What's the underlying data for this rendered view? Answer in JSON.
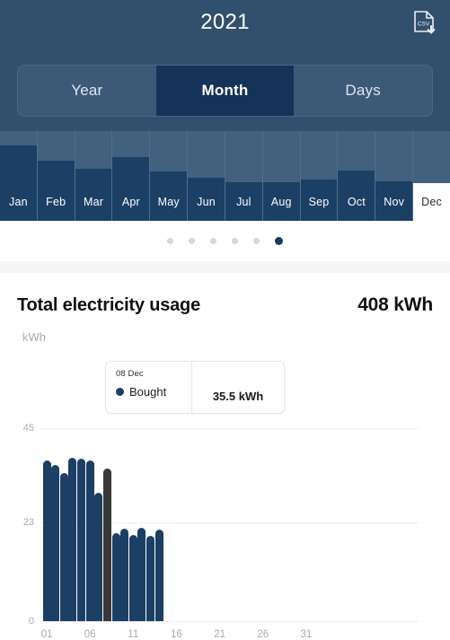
{
  "header": {
    "title": "2021",
    "export_icon": "csv-download-icon"
  },
  "segmented_control": {
    "options": [
      {
        "label": "Year",
        "active": false
      },
      {
        "label": "Month",
        "active": true
      },
      {
        "label": "Days",
        "active": false
      }
    ]
  },
  "month_strip": {
    "months": [
      {
        "label": "Jan",
        "fill_pct": 84,
        "selected": false
      },
      {
        "label": "Feb",
        "fill_pct": 67,
        "selected": false
      },
      {
        "label": "Mar",
        "fill_pct": 58,
        "selected": false
      },
      {
        "label": "Apr",
        "fill_pct": 71,
        "selected": false
      },
      {
        "label": "May",
        "fill_pct": 55,
        "selected": false
      },
      {
        "label": "Jun",
        "fill_pct": 48,
        "selected": false
      },
      {
        "label": "Jul",
        "fill_pct": 43,
        "selected": false
      },
      {
        "label": "Aug",
        "fill_pct": 43,
        "selected": false
      },
      {
        "label": "Sep",
        "fill_pct": 46,
        "selected": false
      },
      {
        "label": "Oct",
        "fill_pct": 56,
        "selected": false
      },
      {
        "label": "Nov",
        "fill_pct": 44,
        "selected": false
      },
      {
        "label": "Dec",
        "fill_pct": 42,
        "selected": true
      }
    ]
  },
  "pagination": {
    "total": 6,
    "active_index": 5
  },
  "usage": {
    "title": "Total electricity usage",
    "value": "408 kWh",
    "unit_label": "kWh"
  },
  "tooltip": {
    "date": "08 Dec",
    "series_label": "Bought",
    "series_color": "#1c3f65",
    "value": "35.5 kWh"
  },
  "chart_data": {
    "type": "bar",
    "title": "Total electricity usage",
    "xlabel": "",
    "ylabel": "kWh",
    "ylim": [
      0,
      45
    ],
    "yticks": [
      0,
      23,
      45
    ],
    "ytick_labels": [
      "0",
      "23",
      "45"
    ],
    "xlim": [
      1,
      31
    ],
    "xticks": [
      1,
      6,
      11,
      16,
      21,
      26,
      31
    ],
    "xtick_labels": [
      "01",
      "06",
      "11",
      "16",
      "21",
      "26",
      "31"
    ],
    "grid": true,
    "legend": [
      "Bought"
    ],
    "series": [
      {
        "name": "Bought",
        "color": "#1c3f65",
        "highlight_color": "#3a3836",
        "x": [
          1,
          2,
          3,
          4,
          5,
          6,
          7,
          8,
          9,
          10,
          11,
          12,
          13,
          14
        ],
        "values": [
          37.5,
          36.5,
          34.5,
          38.0,
          37.8,
          37.4,
          30.0,
          35.5,
          20.6,
          21.6,
          20.0,
          21.8,
          19.9,
          21.3
        ],
        "highlight_index": 7
      }
    ]
  },
  "colors": {
    "header_bg": "#31506e",
    "segment_bg": "#3c5a77",
    "segment_active": "#153358",
    "month_strip_bg": "#41617f",
    "bar_navy": "#1c3f65",
    "bar_selected": "#3a3836",
    "divider": "#f4f5f6"
  }
}
